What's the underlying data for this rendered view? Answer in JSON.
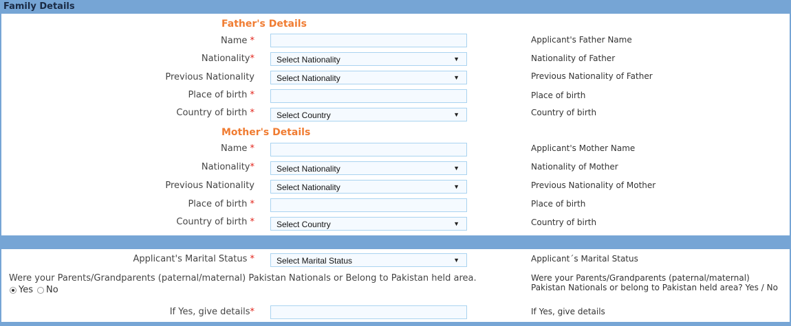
{
  "header": {
    "title": "Family Details"
  },
  "father": {
    "section_title": "Father's Details",
    "name_label": "Name ",
    "nationality_label": "Nationality",
    "prev_nationality_label": "Previous Nationality",
    "place_of_birth_label": "Place of birth ",
    "country_of_birth_label": "Country of birth ",
    "nationality_value": "Select Nationality",
    "prev_nationality_value": "Select Nationality",
    "country_value": "Select Country",
    "help_name": "Applicant's Father Name",
    "help_nationality": "Nationality of Father",
    "help_prev_nationality": "Previous Nationality of Father",
    "help_place": "Place of birth",
    "help_country": "Country of birth"
  },
  "mother": {
    "section_title": "Mother's Details",
    "name_label": "Name ",
    "nationality_label": "Nationality",
    "prev_nationality_label": "Previous Nationality",
    "place_of_birth_label": "Place of birth ",
    "country_of_birth_label": "Country of birth ",
    "nationality_value": "Select Nationality",
    "prev_nationality_value": "Select Nationality",
    "country_value": "Select Country",
    "help_name": "Applicant's Mother Name",
    "help_nationality": "Nationality of Mother",
    "help_prev_nationality": "Previous Nationality of Mother",
    "help_place": "Place of birth",
    "help_country": "Country of birth"
  },
  "marital": {
    "label": "Applicant's Marital Status ",
    "value": "Select Marital Status",
    "help": "Applicant´s Marital Status"
  },
  "pakistan": {
    "question": "Were your Parents/Grandparents (paternal/maternal) Pakistan Nationals or Belong to Pakistan held area.",
    "yes_label": "Yes",
    "no_label": "No",
    "help": "Were your Parents/Grandparents (paternal/maternal) Pakistan Nationals or belong to Pakistan held area? Yes / No",
    "details_label": "If Yes, give details",
    "details_help": "If Yes, give details"
  },
  "common": {
    "required_mark": "*",
    "dropdown_arrow": "▼"
  }
}
